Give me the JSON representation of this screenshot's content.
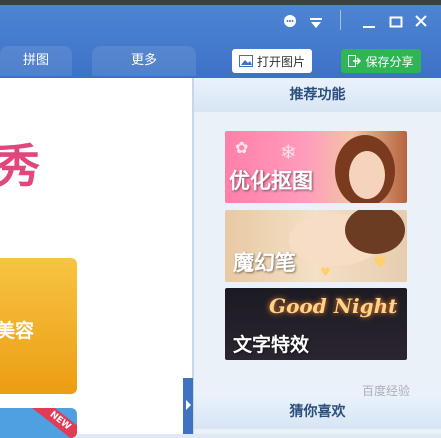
{
  "titlebar": {
    "icons": [
      "chat-icon",
      "dropdown-icon",
      "minimize-icon",
      "maximize-icon",
      "close-icon"
    ]
  },
  "tabs": [
    {
      "label": "拼图"
    },
    {
      "label": "更多"
    }
  ],
  "toolbar": {
    "open_label": "打开图片",
    "save_label": "保存分享"
  },
  "left": {
    "partial_title_char": "秀",
    "orange_label": "美容",
    "new_ribbon": "NEW"
  },
  "sidebar": {
    "section1": "推荐功能",
    "banners": [
      {
        "label": "优化抠图"
      },
      {
        "label": "魔幻笔"
      },
      {
        "label": "文字特效",
        "script": "Good Night"
      }
    ],
    "section2": "猜你喜欢"
  },
  "watermark": "百度经验"
}
